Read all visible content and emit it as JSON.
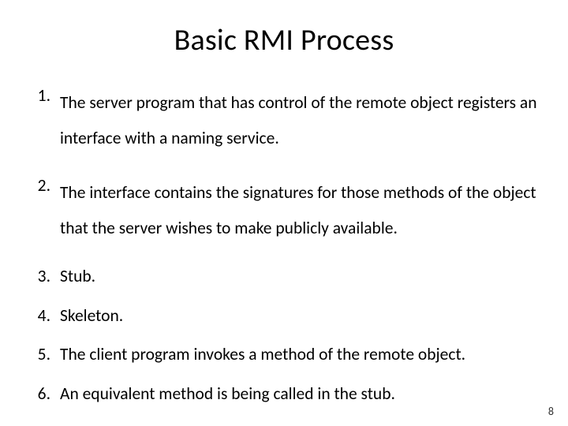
{
  "title": "Basic RMI Process",
  "items": [
    "The server program that has control of the remote object registers an interface with a naming service.",
    "The interface contains the signatures for those methods of the object that the server wishes to make publicly available.",
    "Stub.",
    "Skeleton.",
    "The client program invokes a method of the remote object.",
    "An equivalent method is being called in the stub."
  ],
  "page_number": "8"
}
